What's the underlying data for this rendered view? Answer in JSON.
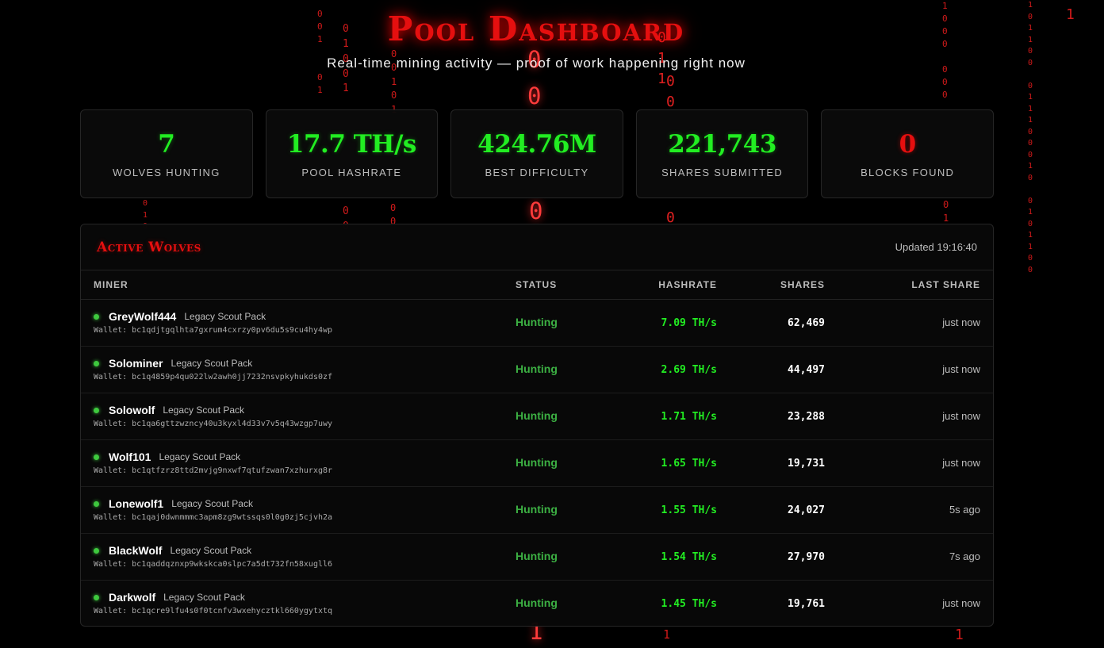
{
  "header": {
    "title": "Pool Dashboard",
    "subtitle": "Real-time mining activity — proof of work happening right now"
  },
  "stats": [
    {
      "value": "7",
      "label": "Wolves Hunting"
    },
    {
      "value": "17.7 TH/s",
      "label": "Pool Hashrate"
    },
    {
      "value": "424.76M",
      "label": "Best Difficulty"
    },
    {
      "value": "221,743",
      "label": "Shares Submitted"
    },
    {
      "value": "0",
      "label": "Blocks Found"
    }
  ],
  "panel": {
    "title": "Active Wolves",
    "updated": "Updated 19:16:40",
    "columns": {
      "miner": "Miner",
      "status": "Status",
      "hashrate": "Hashrate",
      "shares": "Shares",
      "last_share": "Last Share"
    },
    "rows": [
      {
        "name": "GreyWolf444",
        "pack": "Legacy Scout Pack",
        "wallet": "Wallet: bc1qdjtgqlhta7gxrum4cxrzy0pv6du5s9cu4hy4wp",
        "status": "Hunting",
        "hashrate": "7.09 TH/s",
        "shares": "62,469",
        "last": "just now"
      },
      {
        "name": "Solominer",
        "pack": "Legacy Scout Pack",
        "wallet": "Wallet: bc1q4859p4qu022lw2awh0jj7232nsvpkyhukds0zf",
        "status": "Hunting",
        "hashrate": "2.69 TH/s",
        "shares": "44,497",
        "last": "just now"
      },
      {
        "name": "Solowolf",
        "pack": "Legacy Scout Pack",
        "wallet": "Wallet: bc1qa6gttzwzncy40u3kyxl4d33v7v5q43wzgp7uwy",
        "status": "Hunting",
        "hashrate": "1.71 TH/s",
        "shares": "23,288",
        "last": "just now"
      },
      {
        "name": "Wolf101",
        "pack": "Legacy Scout Pack",
        "wallet": "Wallet: bc1qtfzrz8ttd2mvjg9nxwf7qtufzwan7xzhurxg8r",
        "status": "Hunting",
        "hashrate": "1.65 TH/s",
        "shares": "19,731",
        "last": "just now"
      },
      {
        "name": "Lonewolf1",
        "pack": "Legacy Scout Pack",
        "wallet": "Wallet: bc1qaj0dwnmmmc3apm8zg9wtssqs0l0g0zj5cjvh2a",
        "status": "Hunting",
        "hashrate": "1.55 TH/s",
        "shares": "24,027",
        "last": "5s ago"
      },
      {
        "name": "BlackWolf",
        "pack": "Legacy Scout Pack",
        "wallet": "Wallet: bc1qaddqznxp9wkskca0slpc7a5dt732fn58xugll6",
        "status": "Hunting",
        "hashrate": "1.54 TH/s",
        "shares": "27,970",
        "last": "7s ago"
      },
      {
        "name": "Darkwolf",
        "pack": "Legacy Scout Pack",
        "wallet": "Wallet: bc1qcre9lfu4s0f0tcnfv3wxehycztkl660ygytxtq",
        "status": "Hunting",
        "hashrate": "1.45 TH/s",
        "shares": "19,761",
        "last": "just now"
      }
    ]
  },
  "colors": {
    "accent_red": "#e50f0f",
    "accent_green": "#22ee22",
    "status_green": "#3cb043"
  }
}
